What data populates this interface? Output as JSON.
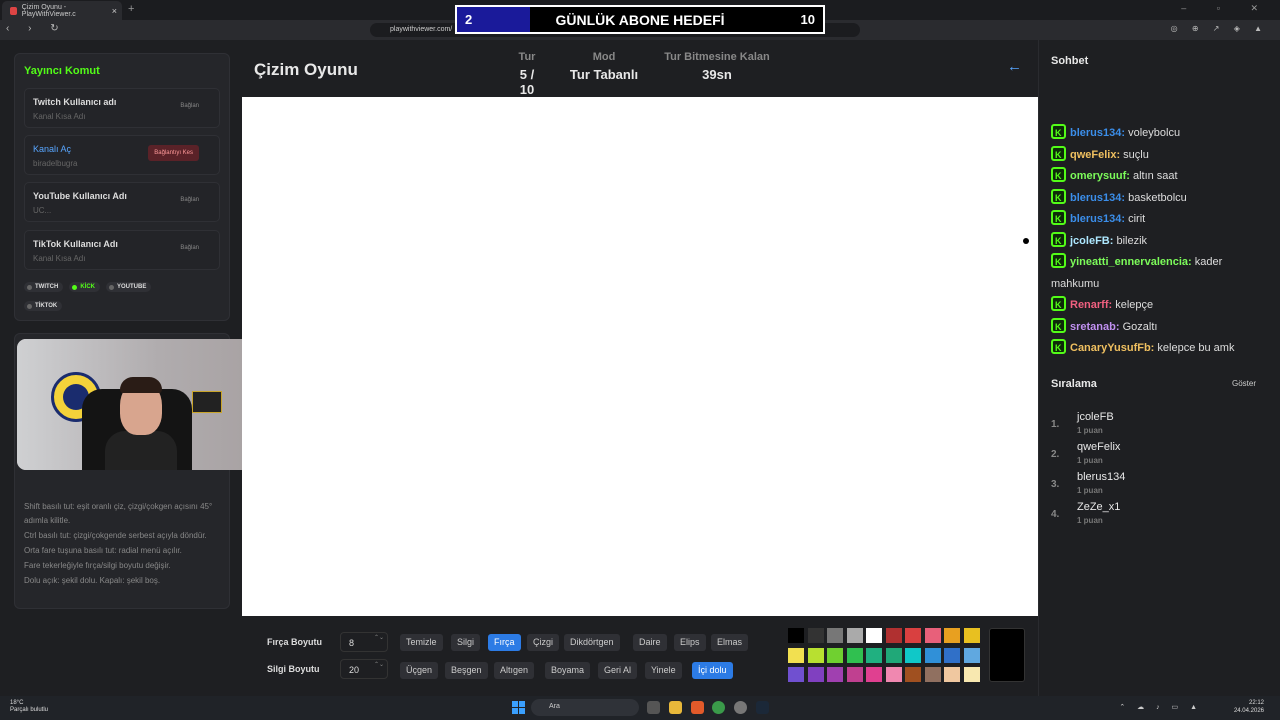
{
  "browser": {
    "tab_title": "Çizim Oyunu - PlayWithViewer.c",
    "tab_close": "×",
    "new_tab": "+",
    "window_controls": "– ▫ ✕",
    "nav": "‹ › ↻",
    "url": "playwithviewer.com/",
    "ext_icons": "◎ ⊕ ↗ ◈ ▲"
  },
  "goal": {
    "current": "2",
    "title": "GÜNLÜK ABONE HEDEFİ",
    "max": "10",
    "progress": 0.2
  },
  "left": {
    "title": "Yayıncı Komut",
    "connections": [
      {
        "label": "Twitch Kullanıcı adı",
        "value": "Kanal Kısa Adı",
        "button": "Bağlan"
      },
      {
        "label": "Kanalı Aç",
        "value": "biradelbugra",
        "button": "Bağlantıyı Kes"
      },
      {
        "label": "YouTube Kullanıcı Adı",
        "value": "UC...",
        "button": "Bağlan"
      },
      {
        "label": "TikTok Kullanıcı Adı",
        "value": "Kanal Kısa Adı",
        "button": "Bağlan"
      }
    ],
    "platforms": [
      "TWITCH",
      "KİCK",
      "YOUTUBE",
      "TİKTOK"
    ],
    "help": [
      "Shift basılı tut: eşit oranlı çiz, çizgi/çokgen açısını 45° adımla kilitle.",
      "Ctrl basılı tut: çizgi/çokgende serbest açıyla döndür.",
      "Orta fare tuşuna basılı tut: radial menü açılır.",
      "Fare tekerleğiyle fırça/silgi boyutu değişir.",
      "Dolu açık: şekil dolu. Kapalı: şekil boş."
    ]
  },
  "game": {
    "title": "Çizim Oyunu",
    "round_label": "Tur",
    "round_value": "5 / 10",
    "mode_label": "Mod",
    "mode_value": "Tur Tabanlı",
    "time_label": "Tur Bitmesine Kalan",
    "time_value": "39sn",
    "back": "←"
  },
  "toolbar": {
    "brush_label": "Fırça Boyutu",
    "brush_value": "8",
    "eraser_label": "Silgi Boyutu",
    "eraser_value": "20",
    "stepper_arrows": "⌃⌄",
    "row1": [
      "Temizle",
      "Silgi",
      "Fırça",
      "Çizgi",
      "Dikdörtgen",
      "Daire",
      "Elips",
      "Elmas"
    ],
    "row2": [
      "Üçgen",
      "Beşgen",
      "Altıgen",
      "Boyama",
      "Geri Al",
      "Yinele",
      "İçi dolu"
    ],
    "active_row1": "Fırça",
    "active_row2": "İçi dolu",
    "palette": [
      "#000000",
      "#333333",
      "#777777",
      "#aaaaaa",
      "#ffffff",
      "#b03030",
      "#d94040",
      "#e8607a",
      "#e8a020",
      "#e8c020",
      "#f2e050",
      "#b8e030",
      "#70d030",
      "#30c050",
      "#20b080",
      "#20a878",
      "#10c8c8",
      "#3090d8",
      "#3070c8",
      "#60a8e0",
      "#7050d0",
      "#8040c0",
      "#a040b0",
      "#c04090",
      "#e04090",
      "#f088b0",
      "#a05020",
      "#907060",
      "#f0c8a0",
      "#f8e8b0"
    ]
  },
  "chat": {
    "title": "Sohbet",
    "messages": [
      {
        "user": "blerus134:",
        "color": "#3b8eea",
        "text": " voleybolcu"
      },
      {
        "user": "qweFelix:",
        "color": "#f0c060",
        "text": " suçlu"
      },
      {
        "user": "omerysuuf:",
        "color": "#7cfc5a",
        "text": " altın saat"
      },
      {
        "user": "blerus134:",
        "color": "#3b8eea",
        "text": " basketbolcu"
      },
      {
        "user": "blerus134:",
        "color": "#3b8eea",
        "text": " cirit"
      },
      {
        "user": "jcoleFB:",
        "color": "#aee8ff",
        "text": " bilezik"
      },
      {
        "user": "yineatti_ennervalencia:",
        "color": "#7cfc5a",
        "text": " kader mahkumu"
      },
      {
        "user": "Renarff:",
        "color": "#f06080",
        "text": " kelepçe"
      },
      {
        "user": "sretanab:",
        "color": "#c090f0",
        "text": " Gozaltı"
      },
      {
        "user": "CanaryYusufFb:",
        "color": "#f0c060",
        "text": " kelepce bu amk"
      }
    ]
  },
  "ranking": {
    "title": "Sıralama",
    "show": "Göster",
    "entries": [
      {
        "n": "1.",
        "name": "jcoleFB",
        "points": "1 puan"
      },
      {
        "n": "2.",
        "name": "qweFelix",
        "points": "1 puan"
      },
      {
        "n": "3.",
        "name": "blerus134",
        "points": "1 puan"
      },
      {
        "n": "4.",
        "name": "ZeZe_x1",
        "points": "1 puan"
      }
    ]
  },
  "taskbar": {
    "temp": "18°C",
    "weather": "Parçalı bulutlu",
    "search": "Ara",
    "tray": "⌃ ☁ ♪ ▭ ▲",
    "time": "22:12",
    "date": "24.04.2026"
  }
}
